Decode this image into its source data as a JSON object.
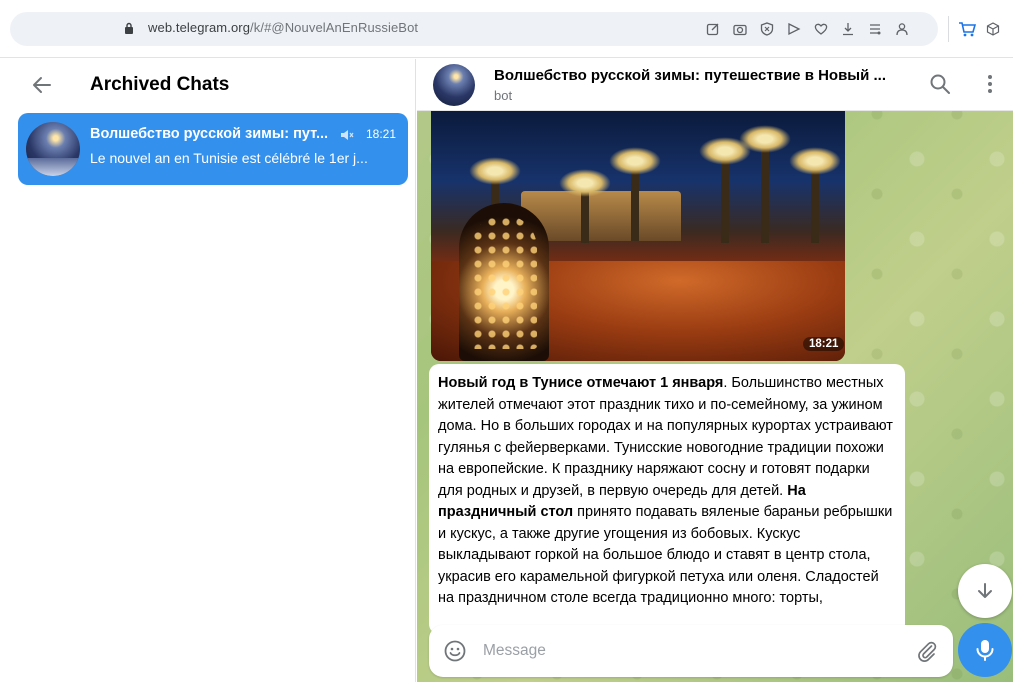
{
  "browser": {
    "url_host": "web.telegram.org",
    "url_path": "/k/#@NouvelAnEnRussieBot",
    "icons": [
      "back-icon",
      "forward-icon",
      "reload-icon",
      "lock-icon",
      "edit-icon",
      "camera-icon",
      "shield-icon",
      "send-icon",
      "heart-icon",
      "download-icon",
      "menu-lines-icon",
      "profile-icon",
      "cart-icon",
      "cube-icon"
    ]
  },
  "sidebar": {
    "title": "Archived Chats",
    "chats": [
      {
        "name": "Волшебство русской зимы: пут...",
        "time": "18:21",
        "preview": "Le nouvel an en Tunisie est célébré le 1er j..."
      }
    ]
  },
  "chat": {
    "title": "Волшебство русской зимы: путешествие в Новый ...",
    "subtitle": "bot",
    "photo_time": "18:21",
    "message": {
      "bold1": "Новый год в Тунисе отмечают 1 января",
      "text1": ". Большинство местных жителей отмечают этот праздник тихо и по-семейному, за ужином дома. Но в больших городах и на популярных курортах устраивают гулянья с фейерверками. Тунисские новогодние традиции похожи на европейские. К празднику наряжают сосну и готовят подарки для родных и друзей, в первую очередь для детей. ",
      "bold2": "На праздничный стол",
      "text2": " принято подавать вяленые бараньи ребрышки и кускус, а также другие угощения из бобовых. Кускус выкладывают горкой на большое блюдо и ставят в центр стола, украсив его карамельной фигуркой петуха или оленя. Сладостей на праздничном столе всегда традиционно много: торты,"
    },
    "composer": {
      "placeholder": "Message"
    }
  },
  "colors": {
    "accent": "#3390ec",
    "chat_background": "#a6c57c"
  }
}
